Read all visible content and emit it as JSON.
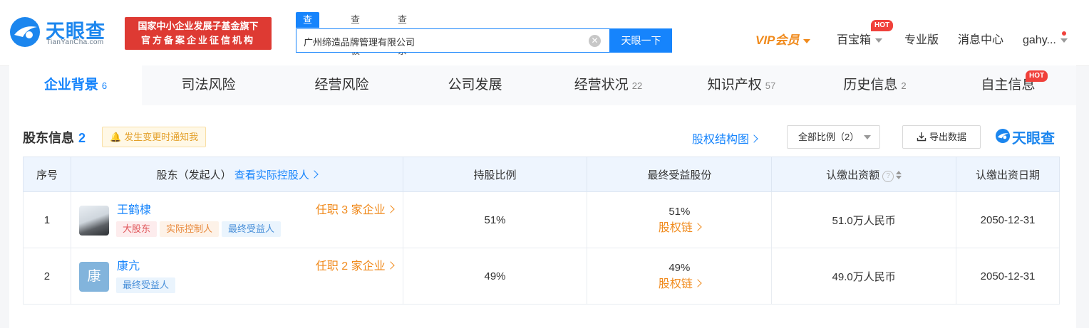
{
  "header": {
    "logo": {
      "name": "天眼查",
      "sub": "TianYanCha.com"
    },
    "banner": {
      "line1": "国家中小企业发展子基金旗下",
      "line2": "官方备案企业征信机构"
    },
    "search": {
      "tabs": [
        "查公司",
        "查老板",
        "查关系"
      ],
      "query": "广州缔造品牌管理有限公司",
      "button": "天眼一下"
    },
    "nav": {
      "vip": "VIP会员",
      "toolbox": "百宝箱",
      "hot": "HOT",
      "pro": "专业版",
      "messages": "消息中心",
      "user": "gahy..."
    }
  },
  "tabs": [
    {
      "label": "企业背景",
      "count": "6",
      "active": true
    },
    {
      "label": "司法风险",
      "count": ""
    },
    {
      "label": "经营风险",
      "count": ""
    },
    {
      "label": "公司发展",
      "count": ""
    },
    {
      "label": "经营状况",
      "count": "22"
    },
    {
      "label": "知识产权",
      "count": "57"
    },
    {
      "label": "历史信息",
      "count": "2"
    },
    {
      "label": "自主信息",
      "count": "",
      "hot": "HOT"
    }
  ],
  "section": {
    "title": "股东信息",
    "count": "2",
    "notify": "发生变更时通知我",
    "structure_link": "股权结构图",
    "filter": "全部比例（2）",
    "export": "导出数据",
    "brand": "天眼查"
  },
  "table": {
    "headers": {
      "idx": "序号",
      "holder": "股东（发起人）",
      "controller_link": "查看实际控股人",
      "ratio": "持股比例",
      "final": "最终受益股份",
      "capital": "认缴出资额",
      "date": "认缴出资日期"
    },
    "rows": [
      {
        "idx": "1",
        "name": "王鹤棣",
        "avatar_char": "",
        "posts": "任职 3 家企业",
        "tags": [
          "大股东",
          "实际控制人",
          "最终受益人"
        ],
        "ratio": "51%",
        "final_pct": "51%",
        "chain": "股权链",
        "capital": "51.0万人民币",
        "date": "2050-12-31"
      },
      {
        "idx": "2",
        "name": "康亢",
        "avatar_char": "康",
        "posts": "任职 2 家企业",
        "tags": [
          "最终受益人"
        ],
        "ratio": "49%",
        "final_pct": "49%",
        "chain": "股权链",
        "capital": "49.0万人民币",
        "date": "2050-12-31"
      }
    ]
  },
  "colors": {
    "brand_blue": "#1684fc",
    "orange": "#f08a1c",
    "banner_red": "#de3a33"
  },
  "icons": [
    "tianyancha-logo-icon",
    "clear-icon",
    "caret-down-icon",
    "bell-icon",
    "chevron-right-icon",
    "export-icon",
    "question-icon",
    "sort-icon"
  ]
}
